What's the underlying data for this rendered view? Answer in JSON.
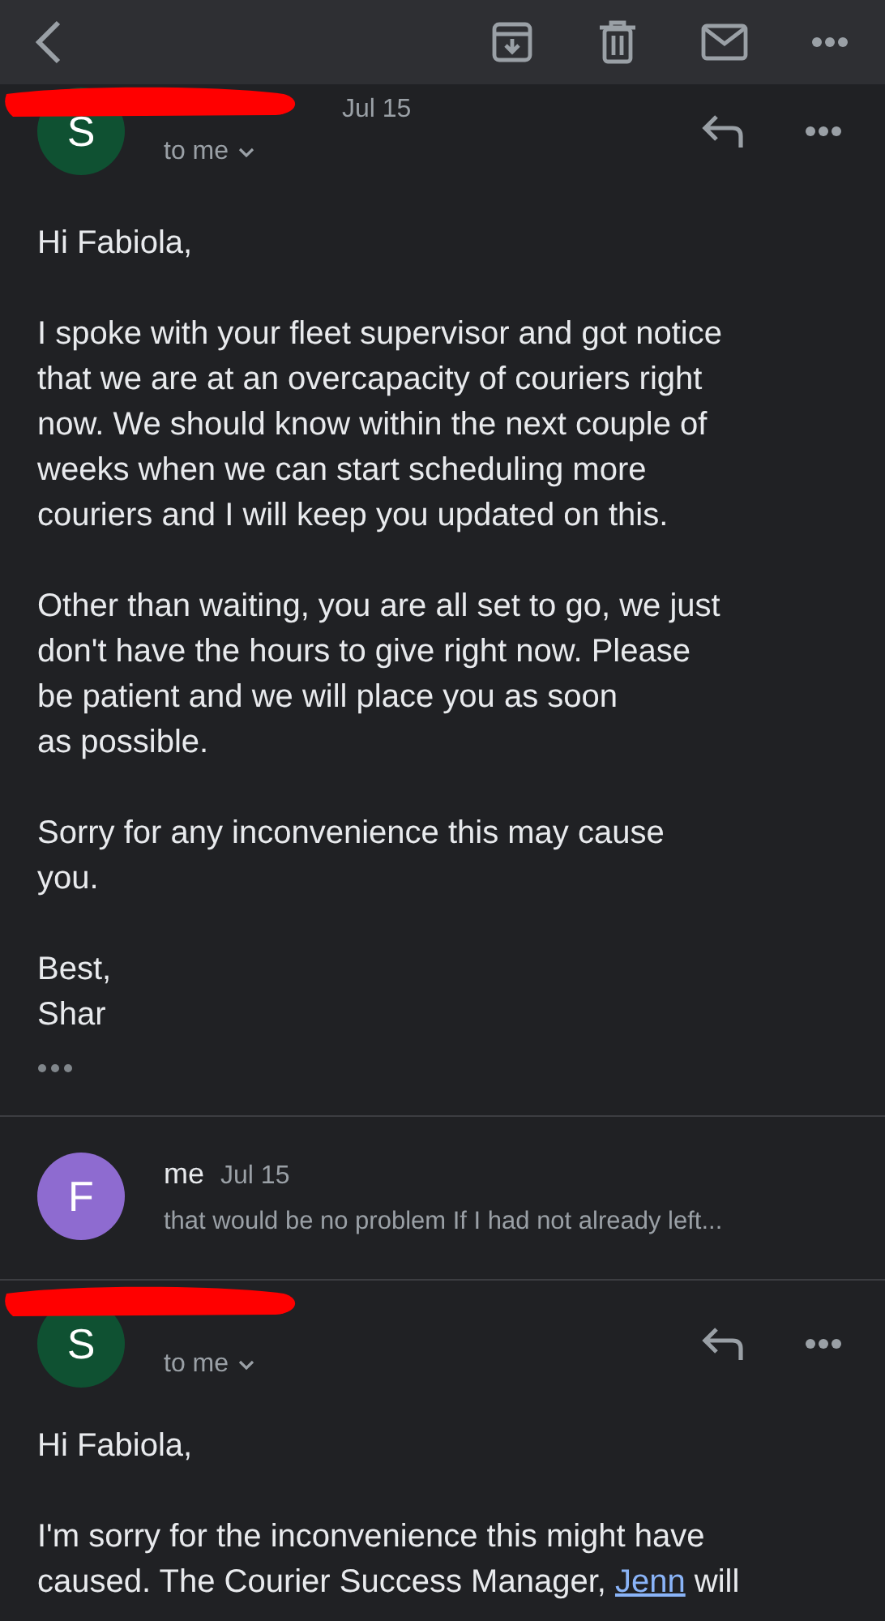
{
  "toolbar": {
    "buttons": [
      {
        "kind": "back"
      },
      {
        "kind": "archive"
      },
      {
        "kind": "delete"
      },
      {
        "kind": "unread"
      },
      {
        "kind": "more"
      }
    ]
  },
  "messages": [
    {
      "kind": "expanded",
      "avatar": "S",
      "color": "#0f5132",
      "sender_redacted": true,
      "date": "Jul 15",
      "recipient": "to me",
      "greeting": "Hi Fabiola,",
      "paragraphs": [
        [
          "I spoke with your fleet supervisor and got notice",
          "that we are at an overcapacity of couriers right",
          "now. We should know within the next couple of",
          "weeks when we can start scheduling more",
          "couriers and I will keep you updated on this."
        ],
        [
          "Other than waiting, you are all set to go, we just",
          "don't have the hours to give right now. Please",
          "be patient and we will place you as soon",
          "as possible."
        ],
        [
          "Sorry for any inconvenience this may cause",
          "you."
        ],
        [
          "Best,",
          "Shar"
        ]
      ],
      "trimmed": true
    },
    {
      "kind": "collapsed",
      "avatar": "F",
      "color": "#8e6bd0",
      "sender": "me",
      "date": "Jul 15",
      "snippet": "that would be no problem If I had not already left..."
    },
    {
      "kind": "expanded",
      "avatar": "S",
      "color": "#0f5132",
      "sender_redacted": true,
      "recipient": "to me",
      "greeting": "Hi Fabiola,",
      "paragraphs": [
        [
          "I'm sorry for the inconvenience this might have",
          [
            {
              "text": "caused. The Courier Success Manager, ",
              "link": false
            },
            {
              "text": "Jenn",
              "link": true
            },
            {
              "text": " will",
              "link": false
            }
          ]
        ]
      ]
    }
  ]
}
